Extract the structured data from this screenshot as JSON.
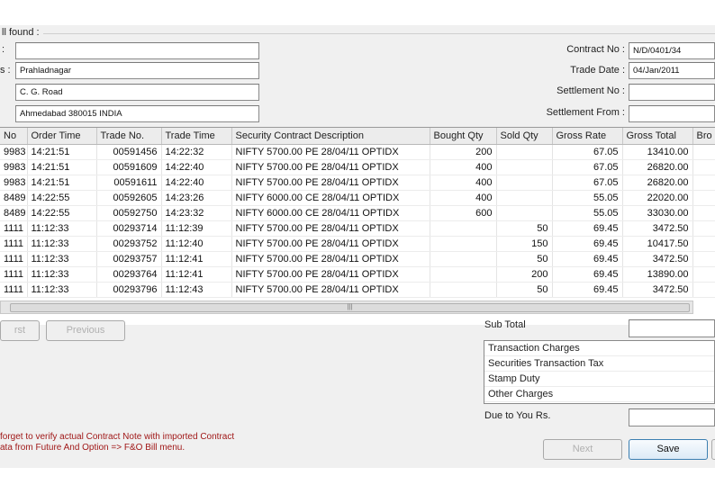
{
  "group_title": "ll found :",
  "left_fields": {
    "label1": ":",
    "label2": "s :",
    "field1": "",
    "field2": "Prahladnagar",
    "field3": "C. G. Road",
    "field4": "Ahmedabad 380015 INDIA"
  },
  "right_fields": {
    "contract_no_label": "Contract No :",
    "contract_no_value": "N/D/0401/34",
    "trade_date_label": "Trade Date :",
    "trade_date_value": "04/Jan/2011",
    "settlement_no_label": "Settlement No :",
    "settlement_no_value": "",
    "settlement_from_label": "Settlement From :",
    "settlement_from_value": ""
  },
  "table": {
    "columns": [
      "No",
      "Order Time",
      "Trade No.",
      "Trade Time",
      "Security Contract Description",
      "Bought Qty",
      "Sold Qty",
      "Gross Rate",
      "Gross Total",
      "Bro"
    ],
    "rows": [
      [
        "9983",
        "14:21:51",
        "00591456",
        "14:22:32",
        "NIFTY 5700.00 PE 28/04/11 OPTIDX",
        "200",
        "",
        "67.05",
        "13410.00",
        ""
      ],
      [
        "9983",
        "14:21:51",
        "00591609",
        "14:22:40",
        "NIFTY 5700.00 PE 28/04/11 OPTIDX",
        "400",
        "",
        "67.05",
        "26820.00",
        ""
      ],
      [
        "9983",
        "14:21:51",
        "00591611",
        "14:22:40",
        "NIFTY 5700.00 PE 28/04/11 OPTIDX",
        "400",
        "",
        "67.05",
        "26820.00",
        ""
      ],
      [
        "8489",
        "14:22:55",
        "00592605",
        "14:23:26",
        "NIFTY 6000.00 CE 28/04/11 OPTIDX",
        "400",
        "",
        "55.05",
        "22020.00",
        ""
      ],
      [
        "8489",
        "14:22:55",
        "00592750",
        "14:23:32",
        "NIFTY 6000.00 CE 28/04/11 OPTIDX",
        "600",
        "",
        "55.05",
        "33030.00",
        ""
      ],
      [
        "1111",
        "11:12:33",
        "00293714",
        "11:12:39",
        "NIFTY 5700.00 PE 28/04/11 OPTIDX",
        "",
        "50",
        "69.45",
        "3472.50",
        ""
      ],
      [
        "1111",
        "11:12:33",
        "00293752",
        "11:12:40",
        "NIFTY 5700.00 PE 28/04/11 OPTIDX",
        "",
        "150",
        "69.45",
        "10417.50",
        ""
      ],
      [
        "1111",
        "11:12:33",
        "00293757",
        "11:12:41",
        "NIFTY 5700.00 PE 28/04/11 OPTIDX",
        "",
        "50",
        "69.45",
        "3472.50",
        ""
      ],
      [
        "1111",
        "11:12:33",
        "00293764",
        "11:12:41",
        "NIFTY 5700.00 PE 28/04/11 OPTIDX",
        "",
        "200",
        "69.45",
        "13890.00",
        ""
      ],
      [
        "1111",
        "11:12:33",
        "00293796",
        "11:12:43",
        "NIFTY 5700.00 PE 28/04/11 OPTIDX",
        "",
        "50",
        "69.45",
        "3472.50",
        ""
      ]
    ]
  },
  "buttons": {
    "first": "rst",
    "previous": "Previous",
    "next": "Next",
    "save": "Save"
  },
  "summary": {
    "sub_total_label": "Sub Total",
    "sub_total_value": "",
    "charges": [
      "Transaction Charges",
      "Securities Transaction Tax",
      "Stamp Duty",
      "Other Charges"
    ],
    "due_label": "Due to You Rs.",
    "due_value": ""
  },
  "note": {
    "line1": "forget to verify actual Contract Note with imported Contract",
    "line2": "ata from Future And Option => F&O Bill menu."
  }
}
